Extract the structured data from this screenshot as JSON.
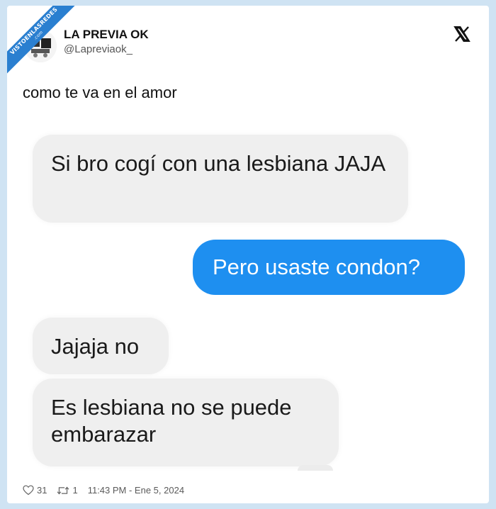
{
  "watermark": {
    "text": "VISTOENLASREDES",
    "subtext": ".com"
  },
  "author": {
    "display_name": "LA PREVIA OK",
    "handle": "@Lapreviaok_",
    "avatar_text": "LA PREVIA OK"
  },
  "tweet": {
    "text": "como te va en el amor"
  },
  "chat": {
    "messages": [
      {
        "direction": "incoming",
        "text": "Si bro cogí con una lesbiana JAJA"
      },
      {
        "direction": "outgoing",
        "text": "Pero usaste condon?"
      },
      {
        "direction": "incoming",
        "text": "Jajaja no"
      },
      {
        "direction": "incoming",
        "text": "Es lesbiana no se puede embarazar"
      }
    ]
  },
  "stats": {
    "likes": "31",
    "retweets": "1",
    "timestamp": "11:43 PM - Ene 5, 2024"
  },
  "colors": {
    "background": "#cfe3f3",
    "card": "#ffffff",
    "outgoing_bubble": "#1e8ff0",
    "incoming_bubble": "#efefef",
    "ribbon": "#2a7fd0"
  },
  "icons": {
    "brand": "x-logo-icon",
    "like": "heart-icon",
    "retweet": "retweet-icon"
  }
}
